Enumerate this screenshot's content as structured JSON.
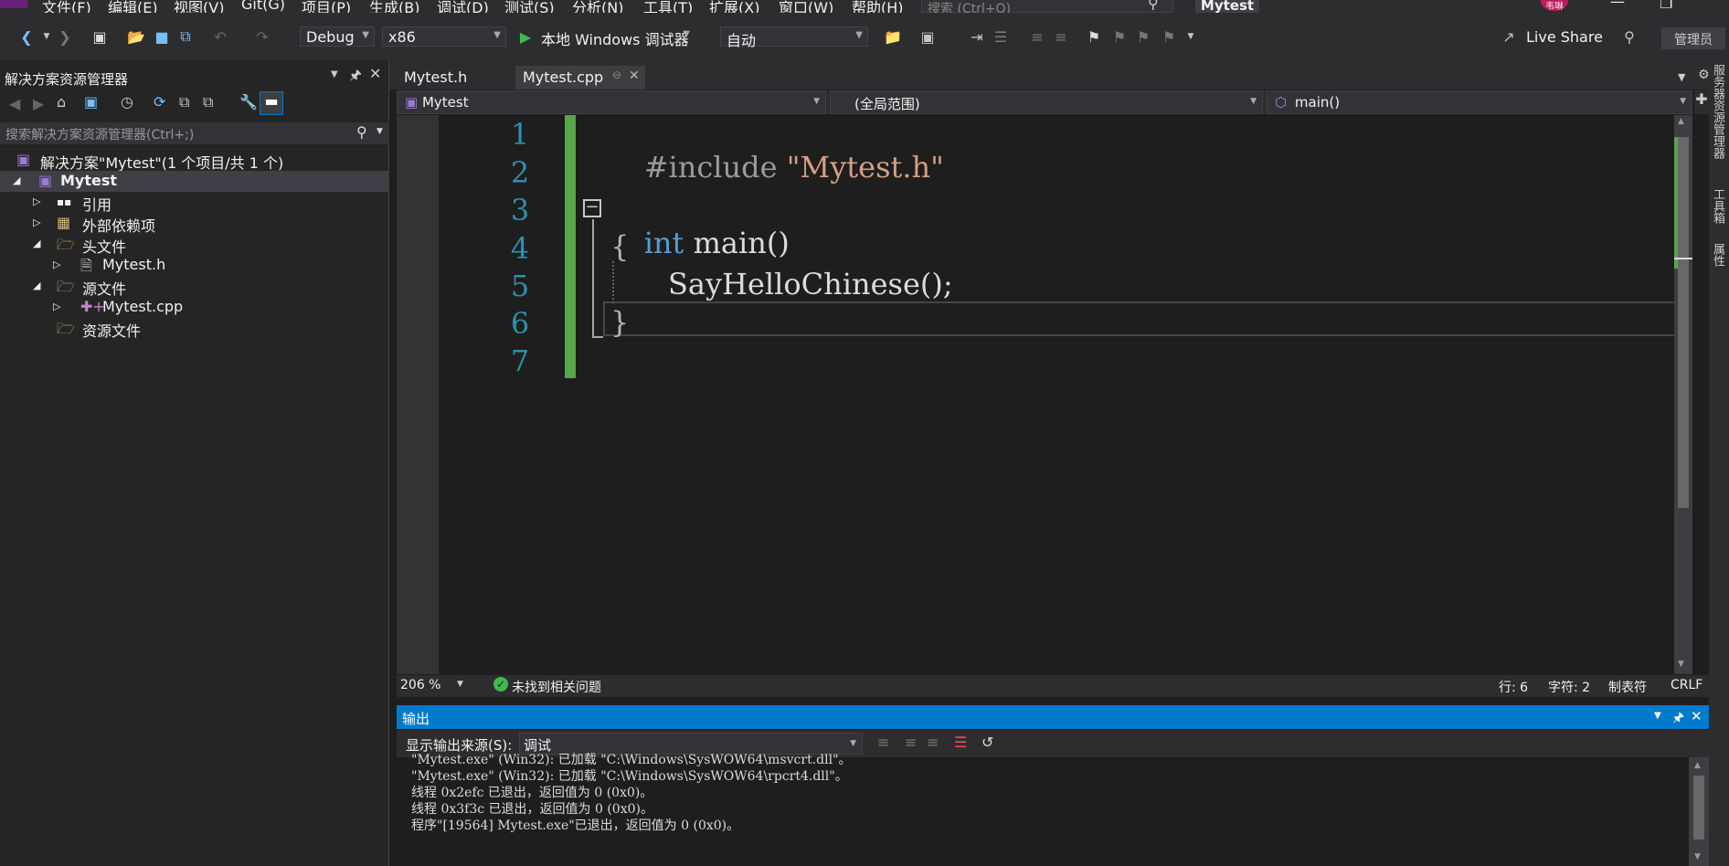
{
  "menu": {
    "items": [
      "文件(F)",
      "编辑(E)",
      "视图(V)",
      "Git(G)",
      "项目(P)",
      "生成(B)",
      "调试(D)",
      "测试(S)",
      "分析(N)",
      "工具(T)",
      "扩展(X)",
      "窗口(W)",
      "帮助(H)"
    ],
    "search_placeholder": "搜索 (Ctrl+Q)",
    "solution_name": "Mytest",
    "user_badge": "韦琳"
  },
  "toolbar": {
    "config": "Debug",
    "platform": "x86",
    "debugger": "本地 Windows 调试器",
    "auto": "自动",
    "live_share": "Live Share",
    "admin": "管理员"
  },
  "solution_explorer": {
    "title": "解决方案资源管理器",
    "search_placeholder": "搜索解决方案资源管理器(Ctrl+;)",
    "solution_label": "解决方案\"Mytest\"(1 个项目/共 1 个)",
    "project": "Mytest",
    "items": [
      {
        "label": "引用"
      },
      {
        "label": "外部依赖项"
      },
      {
        "label": "头文件"
      },
      {
        "label": "Mytest.h"
      },
      {
        "label": "源文件"
      },
      {
        "label": "Mytest.cpp"
      },
      {
        "label": "资源文件"
      }
    ]
  },
  "tabs": [
    {
      "label": "Mytest.h",
      "active": false
    },
    {
      "label": "Mytest.cpp",
      "active": true
    }
  ],
  "nav": {
    "project": "Mytest",
    "scope": "(全局范围)",
    "member": "main()"
  },
  "editor": {
    "line_numbers": [
      "1",
      "2",
      "3",
      "4",
      "5",
      "6",
      "7"
    ],
    "line1_directive": "#include",
    "line1_string": "\"Mytest.h\"",
    "line3_keyword": "int",
    "line3_rest": " main()",
    "line4": "{",
    "line5": "SayHelloChinese();",
    "line6": "}"
  },
  "status": {
    "zoom": "206 %",
    "issues": "未找到相关问题",
    "line": "行: 6",
    "char": "字符: 2",
    "tabs": "制表符",
    "eol": "CRLF"
  },
  "output": {
    "title": "输出",
    "source_label": "显示输出来源(S):",
    "source_value": "调试",
    "lines": [
      "\"Mytest.exe\" (Win32): 已加载 \"C:\\Windows\\SysWOW64\\msvcrt.dll\"。",
      "\"Mytest.exe\" (Win32): 已加载 \"C:\\Windows\\SysWOW64\\rpcrt4.dll\"。",
      "线程 0x2efc 已退出，返回值为 0 (0x0)。",
      "线程 0x3f3c 已退出，返回值为 0 (0x0)。",
      "程序\"[19564] Mytest.exe\"已退出，返回值为 0 (0x0)。"
    ]
  },
  "right_strip": {
    "labels": [
      "服务器资源管理器",
      "工具箱",
      "属性"
    ]
  }
}
